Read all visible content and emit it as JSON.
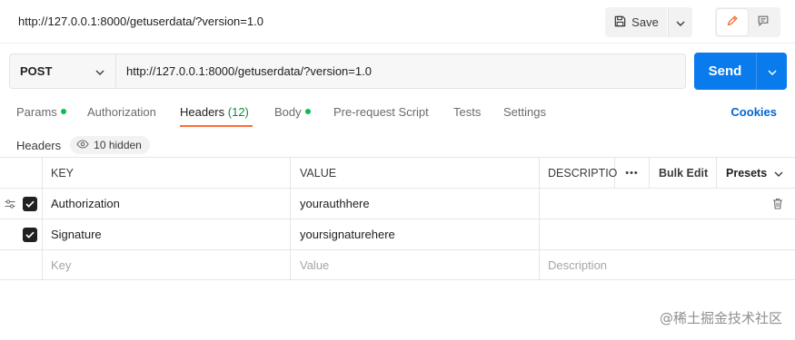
{
  "tab": {
    "title": "http://127.0.0.1:8000/getuserdata/?version=1.0"
  },
  "toolbar": {
    "save_label": "Save"
  },
  "request": {
    "method": "POST",
    "url": "http://127.0.0.1:8000/getuserdata/?version=1.0",
    "send_label": "Send"
  },
  "tabs": {
    "params": "Params",
    "authorization": "Authorization",
    "headers": "Headers",
    "headers_count": "(12)",
    "body": "Body",
    "prerequest": "Pre-request Script",
    "tests": "Tests",
    "settings": "Settings",
    "cookies": "Cookies"
  },
  "headers_section": {
    "label": "Headers",
    "hidden": "10 hidden"
  },
  "table": {
    "columns": {
      "key": "KEY",
      "value": "VALUE",
      "description": "DESCRIPTIO",
      "more": "•••",
      "bulk_edit": "Bulk Edit",
      "presets": "Presets"
    },
    "rows": [
      {
        "key": "Authorization",
        "value": "yourauthhere",
        "description": ""
      },
      {
        "key": "Signature",
        "value": "yoursignaturehere",
        "description": ""
      }
    ],
    "placeholders": {
      "key": "Key",
      "value": "Value",
      "description": "Description"
    }
  },
  "watermark": "@稀土掘金技术社区",
  "colors": {
    "accent": "#097bed",
    "active_tab": "#ff6c37",
    "dot": "#0cbb52",
    "link": "#0265d2"
  }
}
